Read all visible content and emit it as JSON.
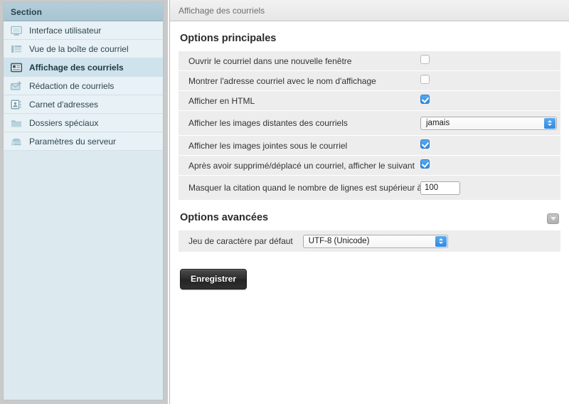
{
  "sidebar": {
    "header_label": "Section",
    "items": [
      {
        "label": "Interface utilisateur",
        "icon": "monitor-icon",
        "selected": false
      },
      {
        "label": "Vue de la boîte de courriel",
        "icon": "mailbox-layout-icon",
        "selected": false
      },
      {
        "label": "Affichage des courriels",
        "icon": "message-display-icon",
        "selected": true
      },
      {
        "label": "Rédaction de courriels",
        "icon": "compose-mail-icon",
        "selected": false
      },
      {
        "label": "Carnet d'adresses",
        "icon": "address-book-icon",
        "selected": false
      },
      {
        "label": "Dossiers spéciaux",
        "icon": "folder-icon",
        "selected": false
      },
      {
        "label": "Paramètres du serveur",
        "icon": "server-icon",
        "selected": false
      }
    ]
  },
  "main": {
    "title": "Affichage des courriels",
    "sections": [
      {
        "heading": "Options principales",
        "rows": [
          {
            "label": "Ouvrir le courriel dans une nouvelle fenêtre",
            "control": "checkbox",
            "checked": false
          },
          {
            "label": "Montrer l'adresse courriel avec le nom d'affichage",
            "control": "checkbox",
            "checked": false
          },
          {
            "label": "Afficher en HTML",
            "control": "checkbox",
            "checked": true
          },
          {
            "label": "Afficher les images distantes des courriels",
            "control": "select",
            "value": "jamais"
          },
          {
            "label": "Afficher les images jointes sous le courriel",
            "control": "checkbox",
            "checked": true
          },
          {
            "label": "Après avoir supprimé/déplacé un courriel, afficher le suivant",
            "control": "checkbox",
            "checked": true
          },
          {
            "label": "Masquer la citation quand le nombre de lignes est supérieur à",
            "control": "text",
            "value": "100"
          }
        ]
      },
      {
        "heading": "Options avancées",
        "collapse_icon": "chevron-down-icon",
        "rows": [
          {
            "label": "Jeu de caractère par défaut",
            "control": "select",
            "value": "UTF-8 (Unicode)"
          }
        ]
      }
    ],
    "save_label": "Enregistrer"
  },
  "colors": {
    "accent": "#2f8ae4",
    "sidebar_bg": "#e8f1f5",
    "sidebar_header": "#a7c4d1",
    "row_bg": "#ededed"
  }
}
